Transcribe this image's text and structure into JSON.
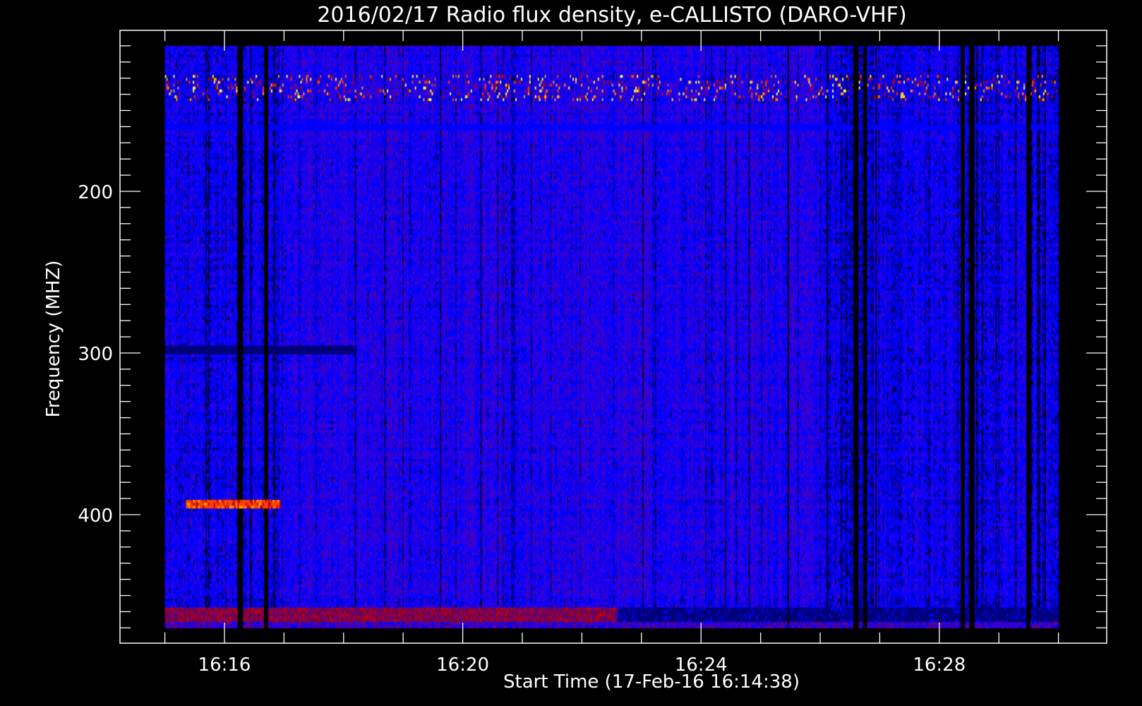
{
  "chart_data": {
    "type": "heatmap",
    "title": "2016/02/17  Radio flux density, e-CALLISTO (DARO-VHF)",
    "xlabel": "Start Time (17-Feb-16 16:14:38)",
    "ylabel": "Frequency (MHZ)",
    "x_unit": "minutes after 16:00 UT",
    "xlim": [
      15,
      30
    ],
    "ylim": [
      470,
      110
    ],
    "x_major_ticks": [
      16,
      20,
      24,
      28
    ],
    "x_tick_labels": [
      "16:16",
      "16:20",
      "16:24",
      "16:28"
    ],
    "x_minor_tick_step": 1,
    "y_major_ticks": [
      200,
      300,
      400
    ],
    "y_tick_labels": [
      "200",
      "300",
      "400"
    ],
    "y_minor_tick_step": 10,
    "colormap": [
      "#000000",
      "#00007a",
      "#0000ff",
      "#3000e0",
      "#5400a0",
      "#700060",
      "#c00000",
      "#ff4000",
      "#ffa000",
      "#ffff40"
    ],
    "features": [
      {
        "name": "rfi-band",
        "freq_range": [
          128,
          145
        ],
        "time_range": [
          15,
          30
        ],
        "intensity": "high, sporadic"
      },
      {
        "name": "narrowband-burst",
        "freq_range": [
          390,
          397
        ],
        "time_range": [
          15.35,
          16.95
        ],
        "intensity": "high"
      },
      {
        "name": "low-band-enhancement",
        "freq_range": [
          458,
          466
        ],
        "time_range": [
          15,
          22.6
        ],
        "intensity": "medium"
      },
      {
        "name": "dark-band",
        "freq_range": [
          296,
          300
        ],
        "time_range": [
          15,
          18.2
        ],
        "intensity": "low"
      },
      {
        "name": "bright-band",
        "freq_range": [
          158,
          162
        ],
        "time_range": [
          15,
          30
        ],
        "intensity": "low-blue"
      },
      {
        "name": "dark-columns",
        "times": [
          16.27,
          16.7,
          26.6,
          26.75,
          28.4,
          28.55,
          29.5
        ]
      }
    ]
  }
}
